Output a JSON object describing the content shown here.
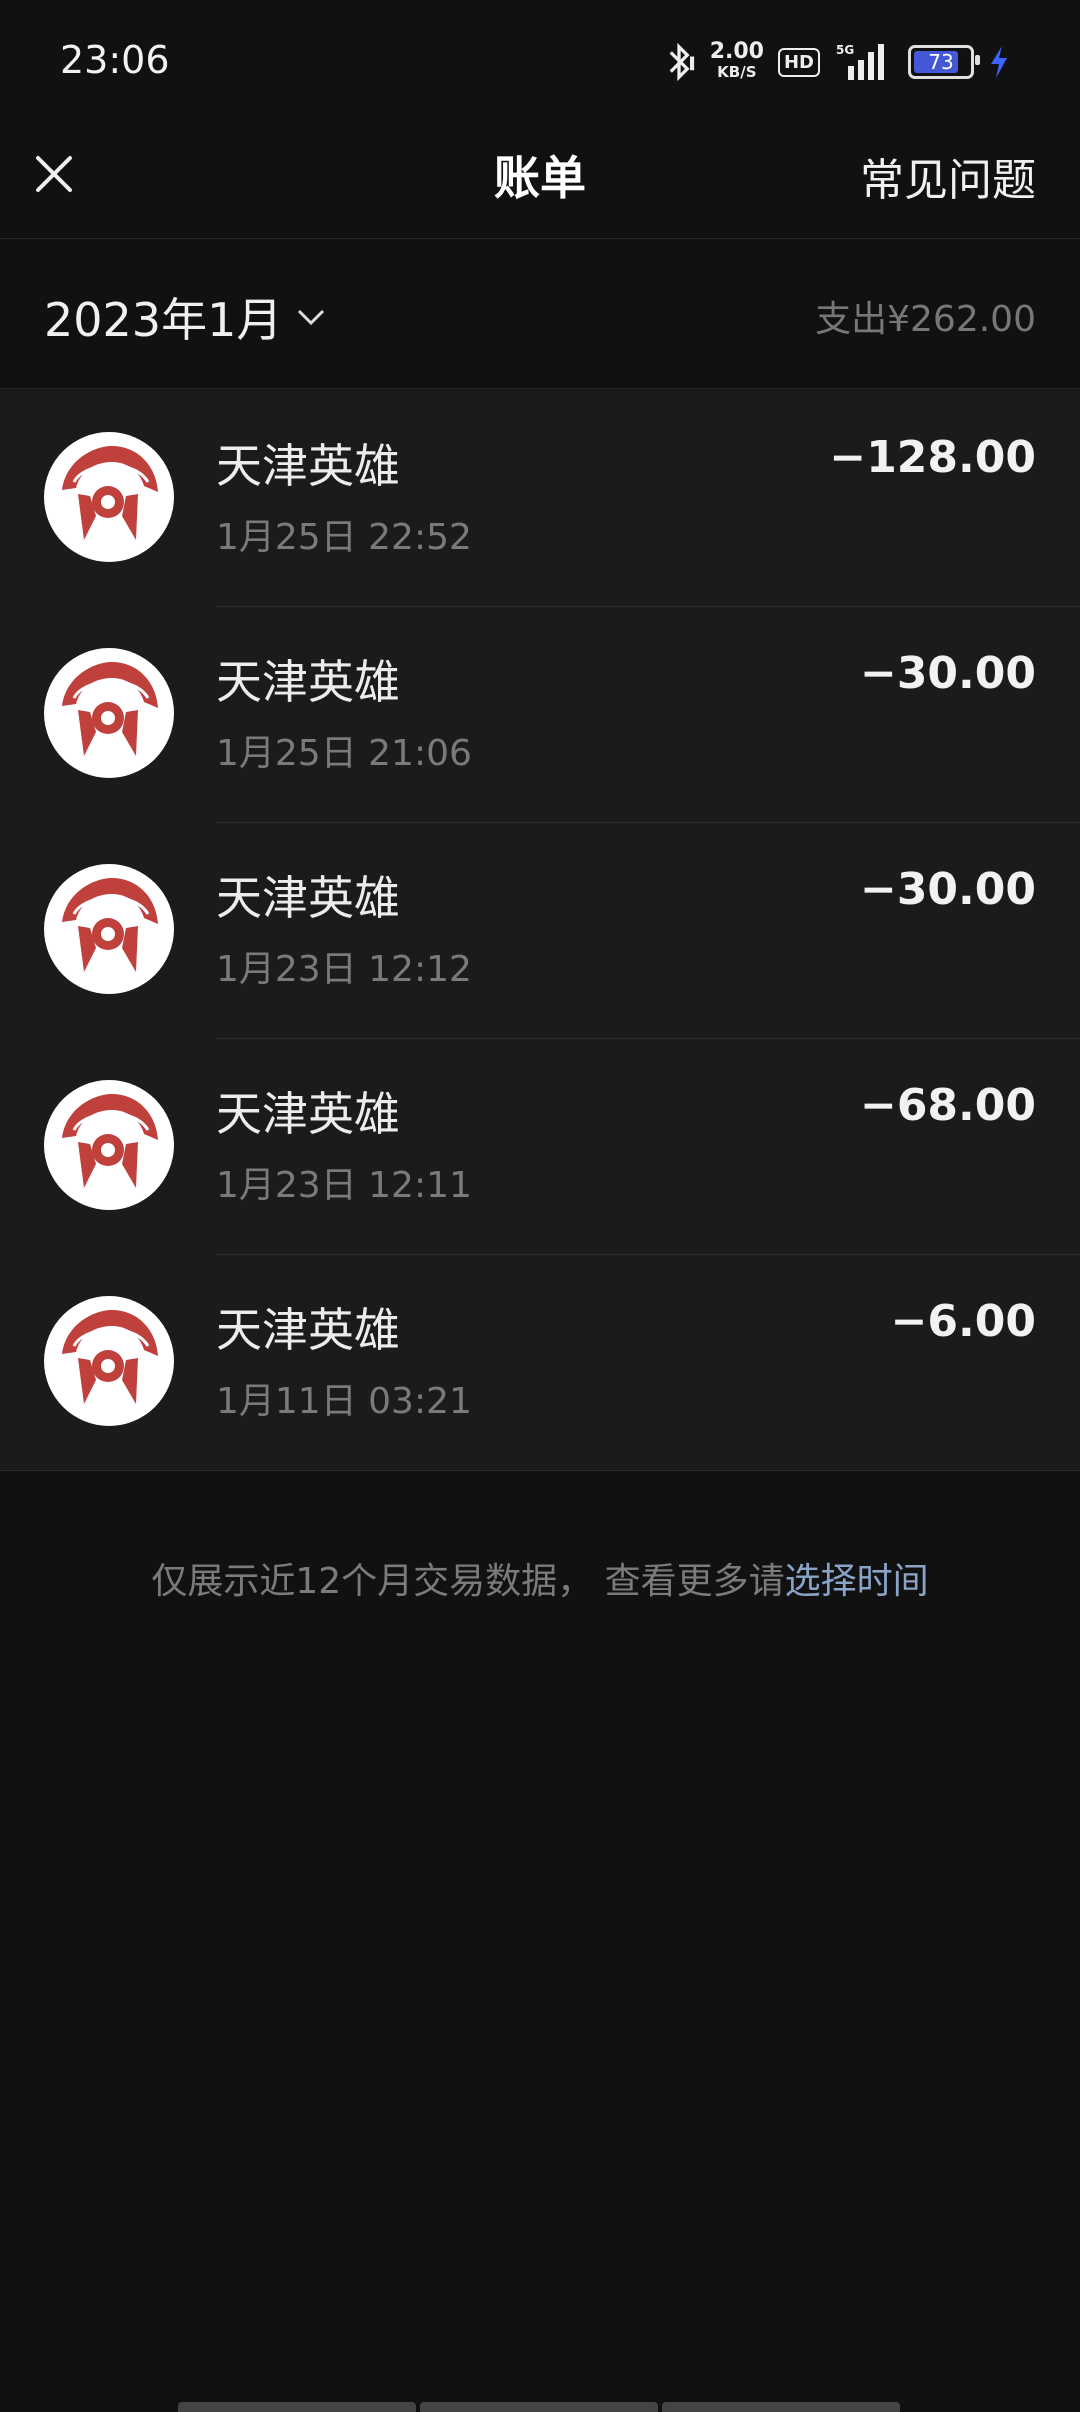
{
  "status": {
    "time": "23:06",
    "speed_value": "2.00",
    "speed_unit": "KB/S",
    "hd": "HD",
    "network": "5G",
    "battery": "73",
    "battery_color": "#4457d6",
    "charging_color": "#3b63ff"
  },
  "header": {
    "title": "账单",
    "faq_label": "常见问题",
    "close_icon": "close-icon"
  },
  "filter": {
    "month_label": "2023年1月",
    "expense_label": "支出¥262.00"
  },
  "transactions": [
    {
      "merchant": "天津英雄",
      "date": "1月25日 22:52",
      "amount": "−128.00"
    },
    {
      "merchant": "天津英雄",
      "date": "1月25日 21:06",
      "amount": "−30.00"
    },
    {
      "merchant": "天津英雄",
      "date": "1月23日 12:12",
      "amount": "−30.00"
    },
    {
      "merchant": "天津英雄",
      "date": "1月23日 12:11",
      "amount": "−68.00"
    },
    {
      "merchant": "天津英雄",
      "date": "1月11日 03:21",
      "amount": "−6.00"
    }
  ],
  "footer": {
    "note": "仅展示近12个月交易数据， 查看更多请",
    "link": "选择时间"
  },
  "colors": {
    "background": "#111111",
    "list_background": "#1b1b1b",
    "logo_red": "#c0403b",
    "link": "#8aa4c8"
  }
}
